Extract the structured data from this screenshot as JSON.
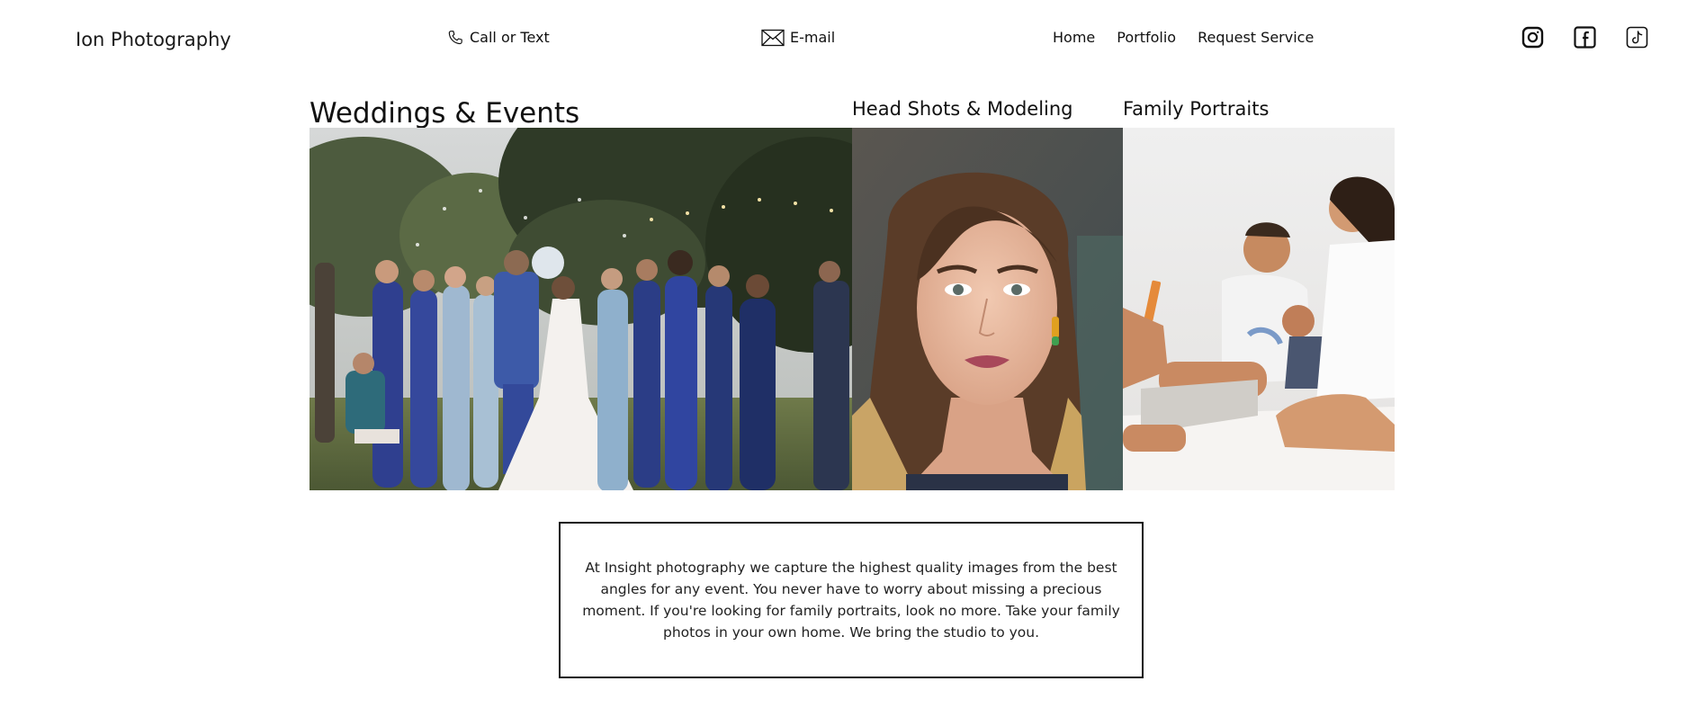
{
  "header": {
    "brand": "Ion Photography",
    "call_label": "Call or Text",
    "email_label": "E-mail",
    "nav": [
      {
        "label": "Home"
      },
      {
        "label": "Portfolio"
      },
      {
        "label": "Request Service"
      }
    ],
    "social_icons": [
      "instagram-icon",
      "facebook-icon",
      "tiktok-icon"
    ]
  },
  "gallery": {
    "weddings_title": "Weddings & Events",
    "headshots_title": "Head Shots & Modeling",
    "family_title": "Family Portraits"
  },
  "about": {
    "text": "At Insight photography we capture the highest quality images from the best angles for any event. You never have to worry about missing a precious moment. If you're looking for family portraits, look no more. Take your family photos in your own home. We bring the studio to you."
  },
  "colors": {
    "text": "#111111",
    "background": "#ffffff",
    "wedding_dress_blue": "#2f3f8f",
    "foliage": "#4a5a3a"
  }
}
